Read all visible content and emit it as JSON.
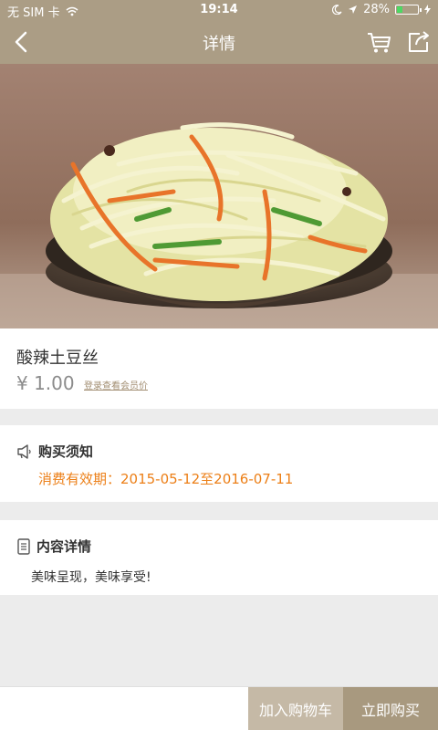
{
  "status_bar": {
    "carrier": "无 SIM 卡",
    "time": "19:14",
    "battery_percent": "28%",
    "battery_level": 0.28,
    "icons": [
      "wifi-icon",
      "moon-icon",
      "location-arrow-icon",
      "battery-icon",
      "charging-icon"
    ]
  },
  "nav": {
    "title": "详情",
    "icons": [
      "back-arrow-icon",
      "cart-icon",
      "share-icon"
    ]
  },
  "product": {
    "name": "酸辣土豆丝",
    "price": "¥ 1.00",
    "member_price_link": "登录查看会员价"
  },
  "notice": {
    "label": "购买须知",
    "validity": "消费有效期：2015-05-12至2016-07-11",
    "icon": "megaphone-icon"
  },
  "detail": {
    "label": "内容详情",
    "body": "美味呈现，美味享受!",
    "icon": "document-icon"
  },
  "actions": {
    "add_to_cart": "加入购物车",
    "buy_now": "立即购买"
  },
  "colors": {
    "header": "#ab9d85",
    "accent_orange": "#ec7f17",
    "cart_button": "#c5b9a6",
    "buy_button": "#a8997f"
  }
}
